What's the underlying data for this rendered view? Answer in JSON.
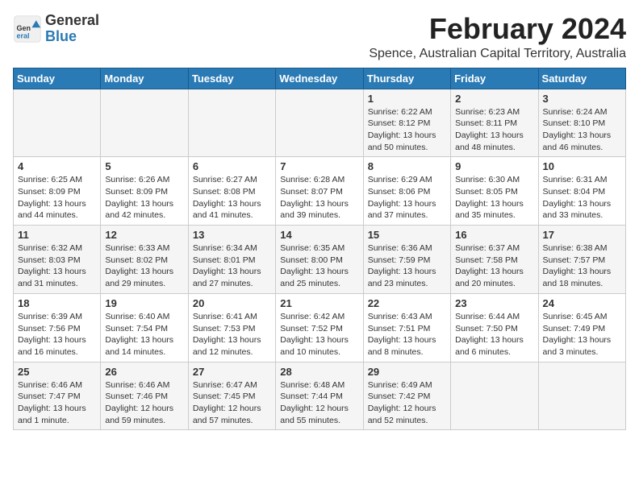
{
  "logo": {
    "general": "General",
    "blue": "Blue"
  },
  "header": {
    "month": "February 2024",
    "location": "Spence, Australian Capital Territory, Australia"
  },
  "weekdays": [
    "Sunday",
    "Monday",
    "Tuesday",
    "Wednesday",
    "Thursday",
    "Friday",
    "Saturday"
  ],
  "weeks": [
    [
      null,
      null,
      null,
      null,
      {
        "day": "1",
        "sunrise": "6:22 AM",
        "sunset": "8:12 PM",
        "daylight": "13 hours and 50 minutes."
      },
      {
        "day": "2",
        "sunrise": "6:23 AM",
        "sunset": "8:11 PM",
        "daylight": "13 hours and 48 minutes."
      },
      {
        "day": "3",
        "sunrise": "6:24 AM",
        "sunset": "8:10 PM",
        "daylight": "13 hours and 46 minutes."
      }
    ],
    [
      {
        "day": "4",
        "sunrise": "6:25 AM",
        "sunset": "8:09 PM",
        "daylight": "13 hours and 44 minutes."
      },
      {
        "day": "5",
        "sunrise": "6:26 AM",
        "sunset": "8:09 PM",
        "daylight": "13 hours and 42 minutes."
      },
      {
        "day": "6",
        "sunrise": "6:27 AM",
        "sunset": "8:08 PM",
        "daylight": "13 hours and 41 minutes."
      },
      {
        "day": "7",
        "sunrise": "6:28 AM",
        "sunset": "8:07 PM",
        "daylight": "13 hours and 39 minutes."
      },
      {
        "day": "8",
        "sunrise": "6:29 AM",
        "sunset": "8:06 PM",
        "daylight": "13 hours and 37 minutes."
      },
      {
        "day": "9",
        "sunrise": "6:30 AM",
        "sunset": "8:05 PM",
        "daylight": "13 hours and 35 minutes."
      },
      {
        "day": "10",
        "sunrise": "6:31 AM",
        "sunset": "8:04 PM",
        "daylight": "13 hours and 33 minutes."
      }
    ],
    [
      {
        "day": "11",
        "sunrise": "6:32 AM",
        "sunset": "8:03 PM",
        "daylight": "13 hours and 31 minutes."
      },
      {
        "day": "12",
        "sunrise": "6:33 AM",
        "sunset": "8:02 PM",
        "daylight": "13 hours and 29 minutes."
      },
      {
        "day": "13",
        "sunrise": "6:34 AM",
        "sunset": "8:01 PM",
        "daylight": "13 hours and 27 minutes."
      },
      {
        "day": "14",
        "sunrise": "6:35 AM",
        "sunset": "8:00 PM",
        "daylight": "13 hours and 25 minutes."
      },
      {
        "day": "15",
        "sunrise": "6:36 AM",
        "sunset": "7:59 PM",
        "daylight": "13 hours and 23 minutes."
      },
      {
        "day": "16",
        "sunrise": "6:37 AM",
        "sunset": "7:58 PM",
        "daylight": "13 hours and 20 minutes."
      },
      {
        "day": "17",
        "sunrise": "6:38 AM",
        "sunset": "7:57 PM",
        "daylight": "13 hours and 18 minutes."
      }
    ],
    [
      {
        "day": "18",
        "sunrise": "6:39 AM",
        "sunset": "7:56 PM",
        "daylight": "13 hours and 16 minutes."
      },
      {
        "day": "19",
        "sunrise": "6:40 AM",
        "sunset": "7:54 PM",
        "daylight": "13 hours and 14 minutes."
      },
      {
        "day": "20",
        "sunrise": "6:41 AM",
        "sunset": "7:53 PM",
        "daylight": "13 hours and 12 minutes."
      },
      {
        "day": "21",
        "sunrise": "6:42 AM",
        "sunset": "7:52 PM",
        "daylight": "13 hours and 10 minutes."
      },
      {
        "day": "22",
        "sunrise": "6:43 AM",
        "sunset": "7:51 PM",
        "daylight": "13 hours and 8 minutes."
      },
      {
        "day": "23",
        "sunrise": "6:44 AM",
        "sunset": "7:50 PM",
        "daylight": "13 hours and 6 minutes."
      },
      {
        "day": "24",
        "sunrise": "6:45 AM",
        "sunset": "7:49 PM",
        "daylight": "13 hours and 3 minutes."
      }
    ],
    [
      {
        "day": "25",
        "sunrise": "6:46 AM",
        "sunset": "7:47 PM",
        "daylight": "13 hours and 1 minute."
      },
      {
        "day": "26",
        "sunrise": "6:46 AM",
        "sunset": "7:46 PM",
        "daylight": "12 hours and 59 minutes."
      },
      {
        "day": "27",
        "sunrise": "6:47 AM",
        "sunset": "7:45 PM",
        "daylight": "12 hours and 57 minutes."
      },
      {
        "day": "28",
        "sunrise": "6:48 AM",
        "sunset": "7:44 PM",
        "daylight": "12 hours and 55 minutes."
      },
      {
        "day": "29",
        "sunrise": "6:49 AM",
        "sunset": "7:42 PM",
        "daylight": "12 hours and 52 minutes."
      },
      null,
      null
    ]
  ]
}
